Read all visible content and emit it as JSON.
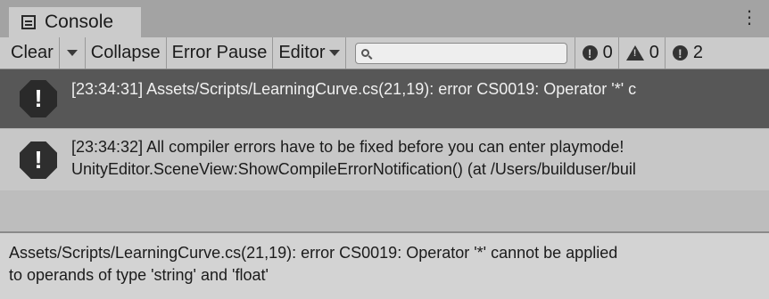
{
  "window": {
    "tab_label": "Console",
    "menu_glyph": "⋮"
  },
  "toolbar": {
    "clear_label": "Clear",
    "collapse_label": "Collapse",
    "error_pause_label": "Error Pause",
    "editor_label": "Editor",
    "search": {
      "value": "",
      "placeholder": ""
    },
    "counters": {
      "info": "0",
      "warning": "0",
      "error": "2"
    }
  },
  "log_entries": [
    {
      "line1": "[23:34:31] Assets/Scripts/LearningCurve.cs(21,19): error CS0019: Operator '*' c",
      "line2": "",
      "selected": true,
      "icon": "error-icon"
    },
    {
      "line1": "[23:34:32] All compiler errors have to be fixed before you can enter playmode!",
      "line2": "UnityEditor.SceneView:ShowCompileErrorNotification() (at /Users/builduser/buil",
      "selected": false,
      "icon": "error-icon"
    }
  ],
  "detail": {
    "line1": "Assets/Scripts/LearningCurve.cs(21,19): error CS0019: Operator '*' cannot be applied",
    "line2": "to operands of type 'string' and 'float'"
  },
  "colors": {
    "selected_row_bg": "#575757",
    "toolbar_bg": "#cbcbcb",
    "tab_strip_bg": "#a3a3a3"
  }
}
